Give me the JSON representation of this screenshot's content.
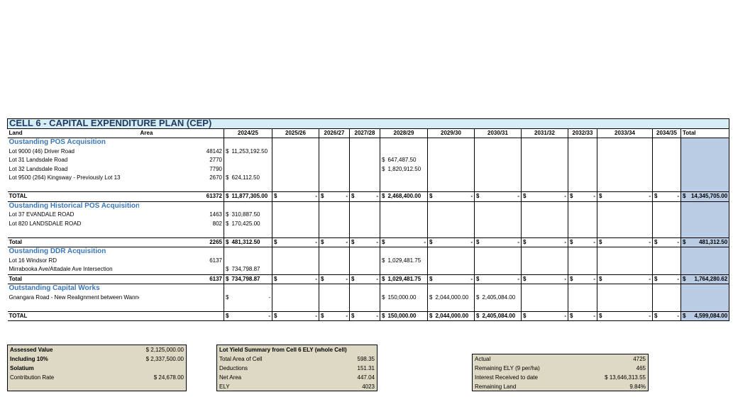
{
  "title": "CELL 6 - CAPITAL EXPENDITURE PLAN (CEP)",
  "headers": {
    "land": "Land",
    "area": "Area",
    "years": [
      "2024/25",
      "2025/26",
      "2026/27",
      "2027/28",
      "2028/29",
      "2029/30",
      "2030/31",
      "2031/32",
      "2032/33",
      "2033/34",
      "2034/35"
    ],
    "total": "Total"
  },
  "dollar": "$",
  "dash": "-",
  "sections": [
    {
      "name": "Oustanding POS Acquisition",
      "rows": [
        {
          "land": "Lot 9000 (46) Driver Road",
          "area": "48142",
          "v0": "$11,253,192.50",
          "v4": ""
        },
        {
          "land": "Lot 31 Landsdale Road",
          "area": "2770",
          "v0": "",
          "v4": "$   647,487.50"
        },
        {
          "land": "Lot 32 Landsdale Road",
          "area": "7790",
          "v0": "",
          "v4": "$ 1,820,912.50"
        },
        {
          "land": "Lot 9500 (264) Kingsway - Previously Lot 13",
          "area": "2670",
          "v0": "$    624,112.50",
          "v4": ""
        }
      ],
      "total": {
        "label": "TOTAL",
        "area": "61372",
        "v0": "$11,877,305.00",
        "v4": "$ 2,468,400.00",
        "v5": "",
        "v6": "",
        "grand": "$ 14,345,705.00"
      }
    },
    {
      "name": "Oustanding Historical POS Acquisition",
      "rows": [
        {
          "land": "Lot 37 EVANDALE ROAD",
          "area": "1463",
          "v0": "$    310,887.50"
        },
        {
          "land": "Lot 820  LANDSDALE ROAD",
          "area": "802",
          "v0": "$    170,425.00"
        }
      ],
      "total": {
        "label": "Total",
        "area": "2265",
        "v0": "$    481,312.50",
        "v4": "$              -",
        "grand": "$     481,312.50"
      }
    },
    {
      "name": "Oustanding DDR Acquisition",
      "rows": [
        {
          "land": "Lot 16 Windsor RD",
          "area": "6137",
          "v0": "",
          "v4": "$ 1,029,481.75"
        },
        {
          "land": "Mirrabooka Ave/Attadale Ave Intersection",
          "area": "",
          "v0": "$    734,798.87",
          "v4": ""
        }
      ],
      "total": {
        "label": "Total",
        "area": "6137",
        "v0": "$    734,798.87",
        "v4": "$ 1,029,481.75",
        "grand": "$   1,764,280.62"
      }
    },
    {
      "name": "Outstanding Capital Works",
      "rows": [
        {
          "land": "Gnangara Road - New Realignment between Wanneroo Rd to Hartman Drive",
          "area": "",
          "v0": "$              -",
          "v4": "$    150,000.00",
          "v5": "$  2,044,000.00",
          "v6": "$2,405,084.00"
        }
      ],
      "total": {
        "label": "TOTAL",
        "area": "",
        "v0": "$              -",
        "v4": "$    150,000.00",
        "v5": "$  2,044,000.00",
        "v6": "$2,405,084.00",
        "grand": "$   4,599,084.00"
      }
    }
  ],
  "assessed": {
    "rows": [
      {
        "label": "Assessed Value",
        "value": "$   2,125,000.00",
        "bold": true
      },
      {
        "label": "Including 10%",
        "value": "$   2,337,500.00",
        "bold": true
      },
      {
        "label": "Solatium",
        "value": "",
        "bold": true
      },
      {
        "label": "Contribution Rate",
        "value": "$          24,678.00",
        "bold": false
      }
    ]
  },
  "lot_yield": {
    "title": "Lot Yield Summary from Cell 6 ELY (whole Cell)",
    "rows": [
      {
        "label": "Total Area of Cell",
        "value": "598.35"
      },
      {
        "label": "Deductions",
        "value": "151.31"
      },
      {
        "label": "Net Area",
        "value": "447.04"
      },
      {
        "label": "ELY",
        "value": "4023"
      }
    ]
  },
  "actual": {
    "rows": [
      {
        "label": "Actual",
        "value": "4725"
      },
      {
        "label": "Remaining ELY (9 per/ha)",
        "value": "465"
      },
      {
        "label": "Interest Received to date",
        "value": "$      13,646,313.55"
      },
      {
        "label": "Remaining Land",
        "value": "9.84%"
      }
    ]
  }
}
